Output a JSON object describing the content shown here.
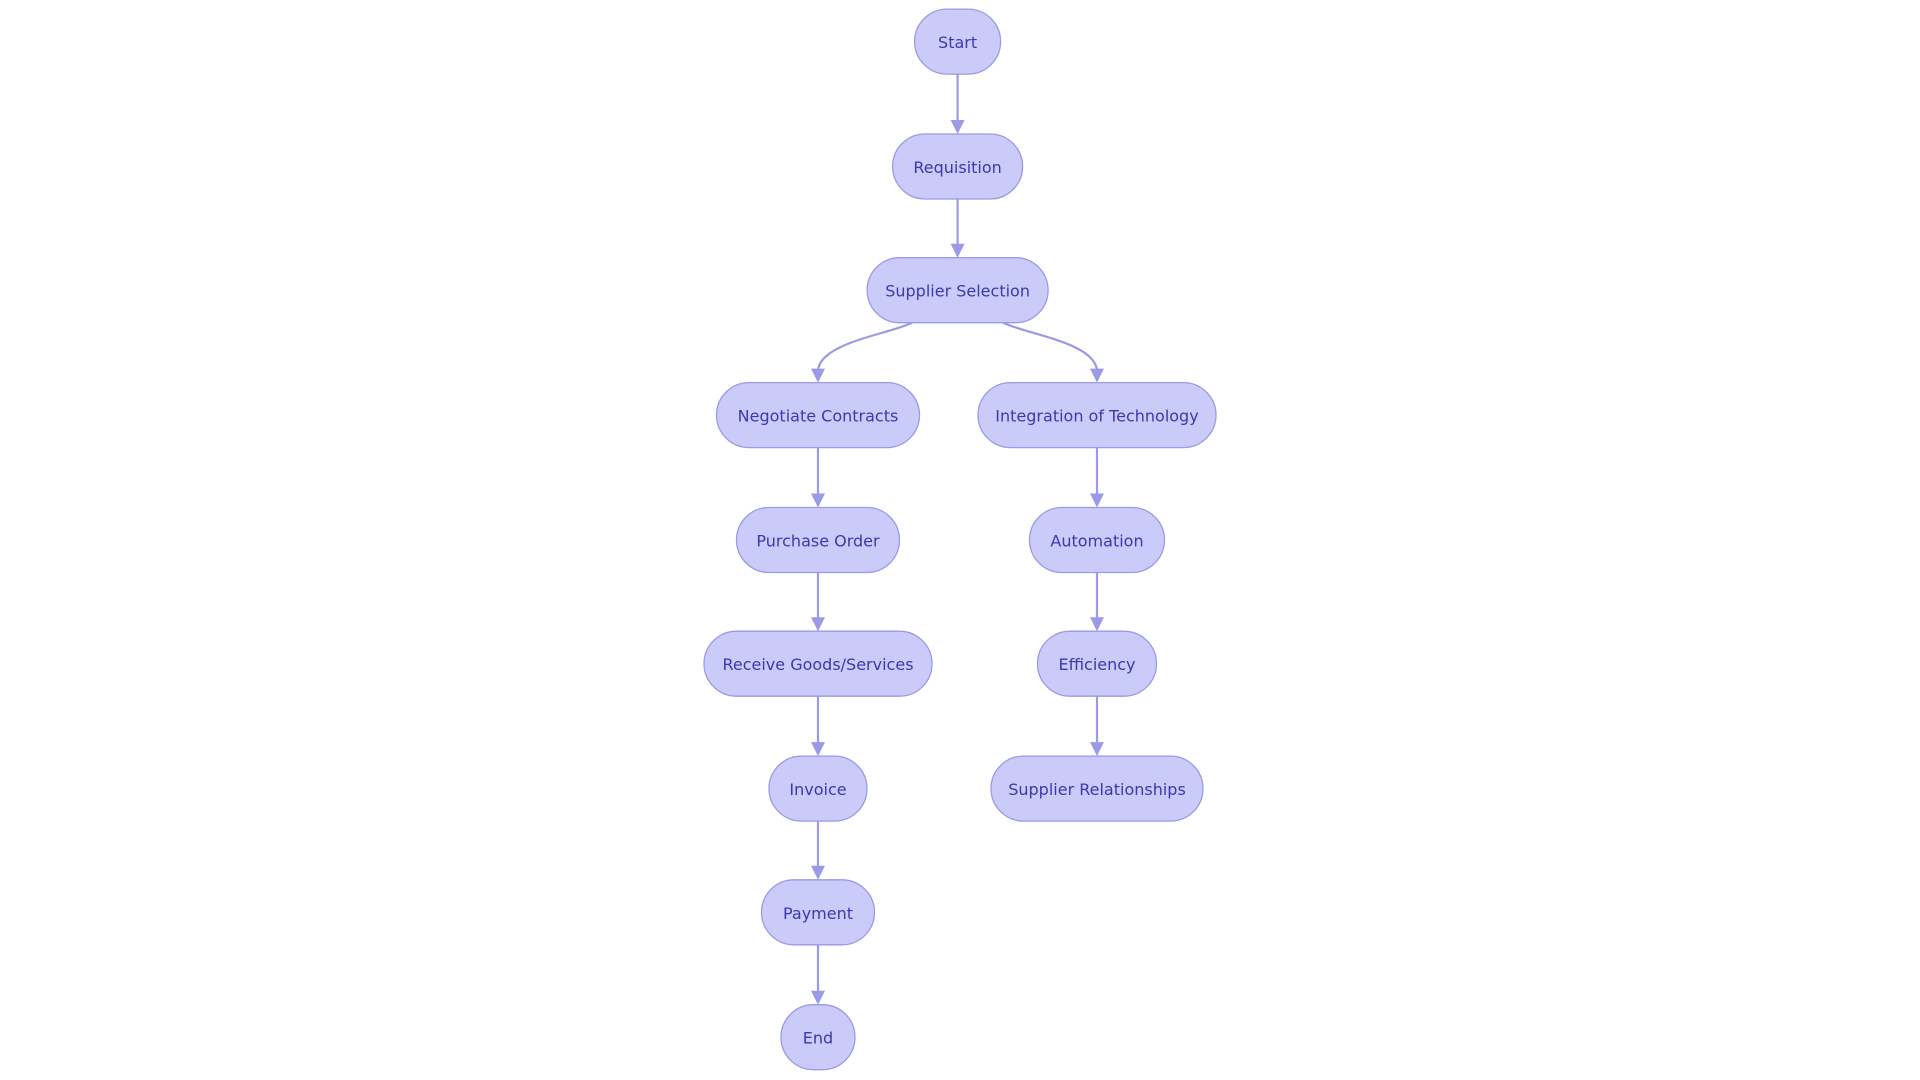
{
  "diagram": {
    "type": "flowchart",
    "direction": "top-down",
    "colors": {
      "node_fill": "#CBCBFA",
      "node_stroke": "#9A9AE6",
      "edge": "#9A9AE6",
      "text": "#3A3AAE",
      "background": "#FFFFFF"
    },
    "nodes": [
      {
        "id": "start",
        "label": "Start"
      },
      {
        "id": "requisition",
        "label": "Requisition"
      },
      {
        "id": "supplier-selection",
        "label": "Supplier Selection"
      },
      {
        "id": "negotiate-contracts",
        "label": "Negotiate Contracts"
      },
      {
        "id": "integration-of-technology",
        "label": "Integration of Technology"
      },
      {
        "id": "purchase-order",
        "label": "Purchase Order"
      },
      {
        "id": "automation",
        "label": "Automation"
      },
      {
        "id": "receive-goods-services",
        "label": "Receive Goods/Services"
      },
      {
        "id": "efficiency",
        "label": "Efficiency"
      },
      {
        "id": "invoice",
        "label": "Invoice"
      },
      {
        "id": "supplier-relationships",
        "label": "Supplier Relationships"
      },
      {
        "id": "payment",
        "label": "Payment"
      },
      {
        "id": "end",
        "label": "End"
      }
    ],
    "edges": [
      {
        "from": "start",
        "to": "requisition"
      },
      {
        "from": "requisition",
        "to": "supplier-selection"
      },
      {
        "from": "supplier-selection",
        "to": "negotiate-contracts"
      },
      {
        "from": "supplier-selection",
        "to": "integration-of-technology"
      },
      {
        "from": "negotiate-contracts",
        "to": "purchase-order"
      },
      {
        "from": "purchase-order",
        "to": "receive-goods-services"
      },
      {
        "from": "receive-goods-services",
        "to": "invoice"
      },
      {
        "from": "invoice",
        "to": "payment"
      },
      {
        "from": "payment",
        "to": "end"
      },
      {
        "from": "integration-of-technology",
        "to": "automation"
      },
      {
        "from": "automation",
        "to": "efficiency"
      },
      {
        "from": "efficiency",
        "to": "supplier-relationships"
      }
    ]
  }
}
